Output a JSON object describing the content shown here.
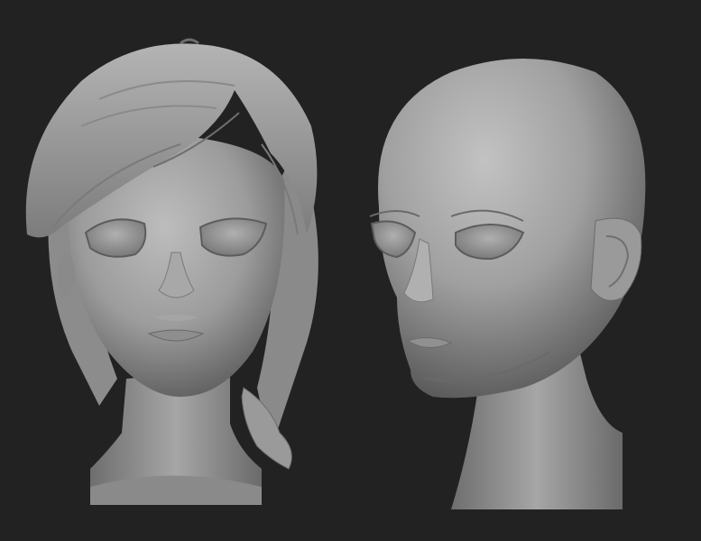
{
  "scene": {
    "background": "#222222",
    "subjects": [
      "head-with-hair-front",
      "bald-head-three-quarter"
    ],
    "material_color": "#9a9a9a"
  }
}
